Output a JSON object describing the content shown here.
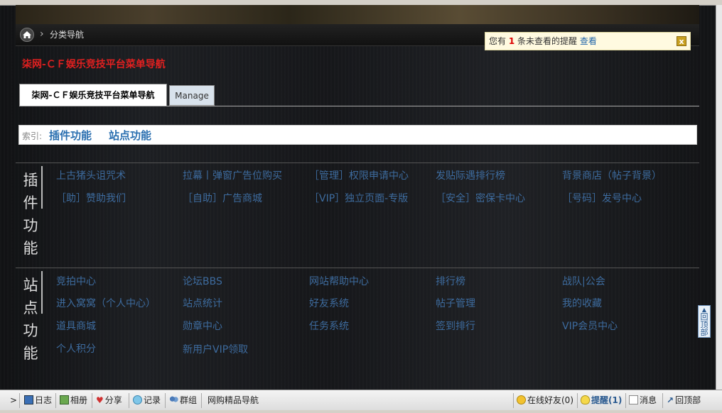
{
  "breadcrumb": {
    "current": "分类导航"
  },
  "notice": {
    "prefix": "您有",
    "count": "1",
    "suffix": "条未查看的提醒",
    "view": "查看",
    "close": "x"
  },
  "page_title": "柒网-ＣＦ娱乐竞技平台菜单导航",
  "tabs": [
    {
      "label": "柒网-ＣＦ娱乐竞技平台菜单导航"
    },
    {
      "label": "Manage"
    }
  ],
  "index": {
    "label": "索引:",
    "links": [
      "插件功能",
      "站点功能"
    ]
  },
  "plugin_section": {
    "title": [
      "插",
      "件",
      "功",
      "能"
    ],
    "links": [
      "上古猪头诅咒术",
      "拉幕丨弹窗广告位购买",
      "［管理］权限申请中心",
      "发贴际遇排行榜",
      "背景商店（帖子背景）",
      "［助］赞助我们",
      "［自助］广告商城",
      "［VIP］独立页面-专版",
      "［安全］密保卡中心",
      "［号码］发号中心"
    ]
  },
  "site_section": {
    "title": [
      "站",
      "点",
      "功",
      "能"
    ],
    "links": [
      "竞拍中心",
      "论坛BBS",
      "网站帮助中心",
      "排行榜",
      "战队|公会",
      "进入窝窝（个人中心）",
      "站点统计",
      "好友系统",
      "帖子管理",
      "我的收藏",
      "道具商城",
      "勋章中心",
      "任务系统",
      "签到排行",
      "VIP会员中心",
      "个人积分",
      "新用户VIP领取"
    ]
  },
  "back_to_top": "回顶部",
  "toolbar": {
    "expand": ">",
    "left": [
      "日志",
      "相册",
      "分享",
      "记录",
      "群组",
      "网购精品导航"
    ],
    "friends": "在线好友(0)",
    "remind": "提醒(1)",
    "messages": "消息",
    "top": "回顶部"
  },
  "colors": {
    "title_red": "#e02020",
    "link_blue": "#3d6b9e",
    "index_blue": "#2a6fb0"
  }
}
